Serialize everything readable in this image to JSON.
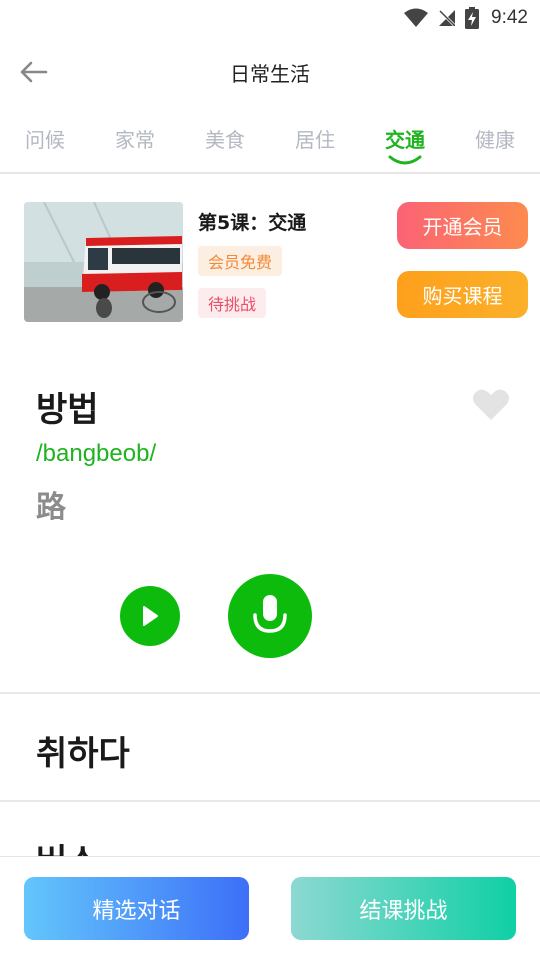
{
  "status_bar": {
    "time": "9:42",
    "icons": [
      "wifi-icon",
      "no-signal-icon",
      "battery-charging-icon"
    ]
  },
  "header": {
    "title": "日常生活",
    "back_icon": "arrow-left-icon"
  },
  "tabs": [
    {
      "label": "问候",
      "active": false
    },
    {
      "label": "家常",
      "active": false
    },
    {
      "label": "美食",
      "active": false
    },
    {
      "label": "居住",
      "active": false
    },
    {
      "label": "交通",
      "active": true
    },
    {
      "label": "健康",
      "active": false
    }
  ],
  "lesson": {
    "title": "第5课：交通",
    "badge_free": "会员免费",
    "badge_status": "待挑战",
    "vip_button": "开通会员",
    "buy_button": "购买课程",
    "thumbnail": "bus-photo"
  },
  "word": {
    "korean": "방법",
    "romanization": "/bangbeob/",
    "meaning": "路",
    "favorite_icon": "heart-icon",
    "play_icon": "play-icon",
    "record_icon": "microphone-icon"
  },
  "word_list": [
    {
      "korean": "취하다"
    },
    {
      "korean": "버스"
    }
  ],
  "bottom": {
    "dialog_button": "精选对话",
    "challenge_button": "结课挑战"
  },
  "colors": {
    "accent_green": "#1fb41f",
    "tab_inactive": "#b3b8c2",
    "vip_orange": "#fb6375",
    "buy_orange": "#fea01c"
  }
}
